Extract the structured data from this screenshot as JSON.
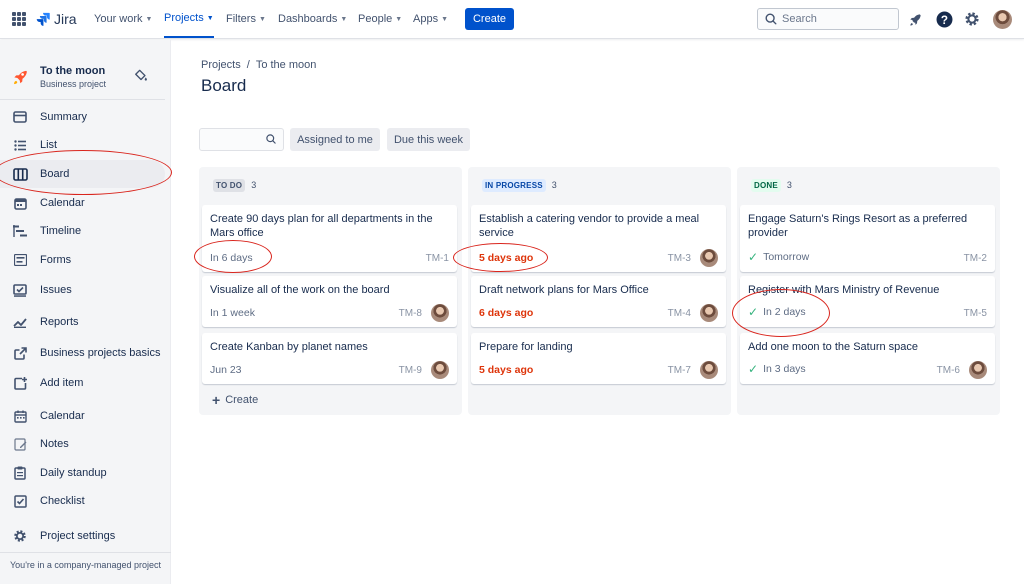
{
  "topnav": {
    "logo_text": "Jira",
    "items": [
      {
        "label": "Your work"
      },
      {
        "label": "Projects"
      },
      {
        "label": "Filters"
      },
      {
        "label": "Dashboards"
      },
      {
        "label": "People"
      },
      {
        "label": "Apps"
      }
    ],
    "create_label": "Create",
    "search_placeholder": "Search"
  },
  "sidebar": {
    "project_name": "To the moon",
    "project_type": "Business project",
    "items": [
      {
        "label": "Summary",
        "icon": "summary-icon"
      },
      {
        "label": "List",
        "icon": "list-icon"
      },
      {
        "label": "Board",
        "icon": "board-icon",
        "active": true
      },
      {
        "label": "Calendar",
        "icon": "calendar-icon"
      },
      {
        "label": "Timeline",
        "icon": "timeline-icon"
      },
      {
        "label": "Forms",
        "icon": "forms-icon"
      },
      {
        "label": "Issues",
        "icon": "issues-icon"
      },
      {
        "label": "Reports",
        "icon": "reports-icon"
      },
      {
        "label": "Business projects basics",
        "icon": "external-link-icon"
      },
      {
        "label": "Add item",
        "icon": "add-item-icon"
      },
      {
        "label": "Calendar",
        "icon": "calendar-icon"
      },
      {
        "label": "Notes",
        "icon": "notes-icon"
      },
      {
        "label": "Daily standup",
        "icon": "clipboard-icon"
      },
      {
        "label": "Checklist",
        "icon": "checklist-icon"
      },
      {
        "label": "Project settings",
        "icon": "gear-icon"
      }
    ],
    "footer": "You're in a company-managed project"
  },
  "main": {
    "breadcrumb": [
      "Projects",
      "To the moon"
    ],
    "breadcrumb_sep": "/",
    "title": "Board",
    "filters": [
      "Assigned to me",
      "Due this week"
    ],
    "columns": [
      {
        "name": "TO DO",
        "count": "3",
        "cards": [
          {
            "title": "Create 90 days plan for all departments in the Mars office",
            "meta": "In 6 days",
            "key": "TM-1",
            "avatar": false
          },
          {
            "title": "Visualize all of the work on the board",
            "meta": "In 1 week",
            "key": "TM-8",
            "avatar": true
          },
          {
            "title": "Create Kanban by planet names",
            "meta": "Jun 23",
            "key": "TM-9",
            "avatar": true
          }
        ]
      },
      {
        "name": "IN PROGRESS",
        "count": "3",
        "cards": [
          {
            "title": "Establish a catering vendor to provide a meal service",
            "meta": "5 days ago",
            "key": "TM-3",
            "avatar": true
          },
          {
            "title": "Draft network plans for Mars Office",
            "meta": "6 days ago",
            "key": "TM-4",
            "avatar": true
          },
          {
            "title": "Prepare for landing",
            "meta": "5 days ago",
            "key": "TM-7",
            "avatar": true
          }
        ]
      },
      {
        "name": "DONE",
        "count": "3",
        "cards": [
          {
            "title": "Engage Saturn's Rings Resort as a preferred provider",
            "meta": "Tomorrow",
            "key": "TM-2",
            "avatar": false
          },
          {
            "title": "Register with Mars Ministry of Revenue",
            "meta": "In 2 days",
            "key": "TM-5",
            "avatar": false
          },
          {
            "title": "Add one moon to the Saturn space",
            "meta": "In 3 days",
            "key": "TM-6",
            "avatar": true
          }
        ]
      }
    ],
    "create_label": "Create"
  },
  "colors": {
    "primary": "#0052cc",
    "overdue": "#de350b",
    "done_green": "#36b37e",
    "annotation_red": "#d9251d",
    "todo_badge_bg": "#dfe1e6",
    "inprogress_badge_bg": "#deebff",
    "done_badge_bg": "#e3fcef"
  }
}
